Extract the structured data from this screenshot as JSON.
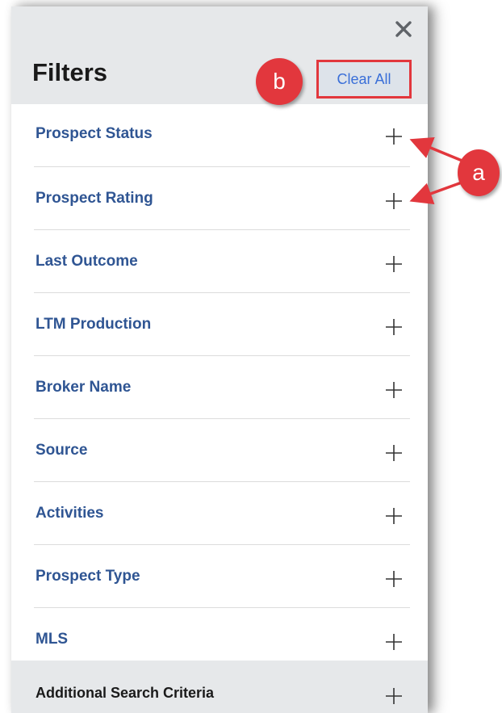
{
  "panel": {
    "title": "Filters",
    "clear_all_label": "Clear All",
    "close_icon": "close-icon"
  },
  "filters": [
    {
      "label": "Prospect Status",
      "icon": "plus-icon"
    },
    {
      "label": "Prospect Rating",
      "icon": "plus-icon"
    },
    {
      "label": "Last Outcome",
      "icon": "plus-icon"
    },
    {
      "label": "LTM Production",
      "icon": "plus-icon"
    },
    {
      "label": "Broker Name",
      "icon": "plus-icon"
    },
    {
      "label": "Source",
      "icon": "plus-icon"
    },
    {
      "label": "Activities",
      "icon": "plus-icon"
    },
    {
      "label": "Prospect Type",
      "icon": "plus-icon"
    },
    {
      "label": "MLS",
      "icon": "plus-icon"
    }
  ],
  "additional": {
    "label": "Additional Search Criteria",
    "icon": "plus-icon"
  },
  "annotations": {
    "a": "a",
    "b": "b"
  },
  "colors": {
    "header_bg": "#e6e8ea",
    "filter_label": "#2f5593",
    "link": "#3a6fd8",
    "annotation_red": "#e2373d"
  }
}
